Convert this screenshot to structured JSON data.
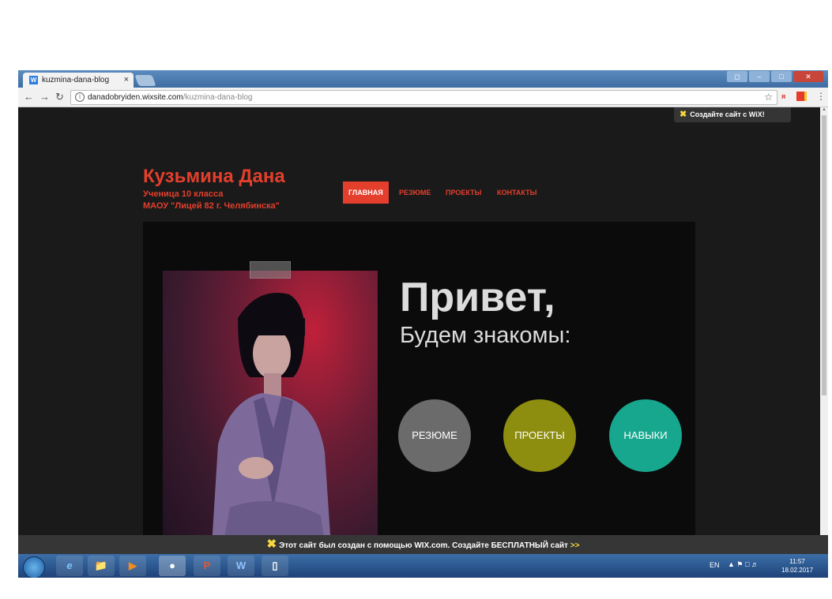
{
  "browser": {
    "tab_title": "kuzmina-dana-blog",
    "tab_close": "×",
    "url_host": "danadobryiden.wixsite.com",
    "url_path": "/kuzmina-dana-blog"
  },
  "site": {
    "wix_badge": "Создайте сайт с WiX!",
    "name": "Кузьмина Дана",
    "subtitle1": "Ученица 10 класса",
    "subtitle2": "МАОУ \"Лицей 82 г. Челябинска\"",
    "menu": [
      "ГЛАВНАЯ",
      "РЕЗЮМЕ",
      "ПРОЕКТЫ",
      "КОНТАКТЫ"
    ],
    "greeting": "Привет,",
    "greeting2": "Будем знакомы:",
    "circles": [
      "РЕЗЮМЕ",
      "ПРОЕКТЫ",
      "НАВЫКИ"
    ],
    "wix_footer": "Этот сайт был создан с помощью WIX.com. Создайте БЕСПЛАТНЫЙ сайт",
    "wix_footer_arrow": ">>"
  },
  "taskbar": {
    "lang": "EN",
    "time": "11:57",
    "date": "18.02.2017"
  },
  "colors": {
    "accent": "#e43f2c",
    "circle_resume": "#6b6b6b",
    "circle_projects": "#8d8d0f",
    "circle_skills": "#17a78e"
  }
}
